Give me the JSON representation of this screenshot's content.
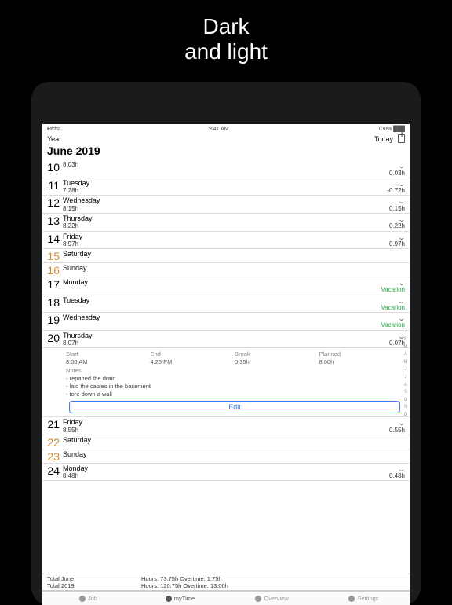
{
  "promo": {
    "line1": "Dark",
    "line2": "and light"
  },
  "status": {
    "left": "iPad ᯤ",
    "center": "9:41 AM",
    "right": "100% ███"
  },
  "nav": {
    "back": "Year",
    "today": "Today"
  },
  "header": {
    "title": "June 2019"
  },
  "days": [
    {
      "num": "10",
      "name": "",
      "hours": "8.03h",
      "diff": "0.03h",
      "chev": true
    },
    {
      "num": "11",
      "name": "Tuesday",
      "hours": "7.28h",
      "diff": "-0.72h",
      "chev": true
    },
    {
      "num": "12",
      "name": "Wednesday",
      "hours": "8.15h",
      "diff": "0.15h",
      "chev": true
    },
    {
      "num": "13",
      "name": "Thursday",
      "hours": "8.22h",
      "diff": "0.22h",
      "chev": true
    },
    {
      "num": "14",
      "name": "Friday",
      "hours": "8.97h",
      "diff": "0.97h",
      "chev": true
    },
    {
      "num": "15",
      "name": "Saturday",
      "weekend": true
    },
    {
      "num": "16",
      "name": "Sunday",
      "weekend": true
    },
    {
      "num": "17",
      "name": "Monday",
      "vac": "Vacation",
      "chev": true
    },
    {
      "num": "18",
      "name": "Tuesday",
      "vac": "Vacation",
      "chev": true
    },
    {
      "num": "19",
      "name": "Wednesday",
      "vac": "Vacation",
      "chev": true
    },
    {
      "num": "20",
      "name": "Thursday",
      "hours": "8.07h",
      "diff": "0.07h",
      "chev": true,
      "open": true
    }
  ],
  "detail": {
    "cols": {
      "start": "Start",
      "end": "End",
      "break": "Break",
      "planned": "Planned"
    },
    "vals": {
      "start": "8:00 AM",
      "end": "4:25 PM",
      "break": "0.35h",
      "planned": "8.00h"
    },
    "notes_label": "Notes",
    "notes": "- repaired the drain\n- laid the cables in the basement\n- tore down a wall",
    "edit": "Edit"
  },
  "days2": [
    {
      "num": "21",
      "name": "Friday",
      "hours": "8.55h",
      "diff": "0.55h",
      "chev": true
    },
    {
      "num": "22",
      "name": "Saturday",
      "weekend": true
    },
    {
      "num": "23",
      "name": "Sunday",
      "weekend": true
    },
    {
      "num": "24",
      "name": "Monday",
      "hours": "8.48h",
      "diff": "0.48h",
      "chev": true
    }
  ],
  "totals": {
    "r1l": "Total June:",
    "r1r": "Hours: 73.75h   Overtime: 1.75h",
    "r2l": "Total 2019:",
    "r2r": "Hours: 120.75h   Overtime: 13.00h"
  },
  "tabs": {
    "job": "Job",
    "mytime": "myTime",
    "overview": "Overview",
    "settings": "Settings"
  },
  "rail": [
    "J",
    "F",
    "M",
    "A",
    "M",
    "J",
    "J",
    "A",
    "S",
    "O",
    "N",
    "D"
  ]
}
